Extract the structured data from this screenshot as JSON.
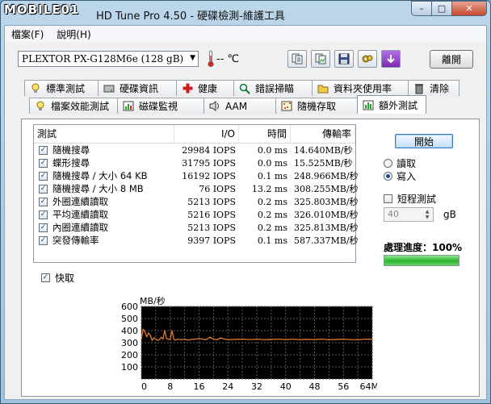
{
  "window": {
    "logo": "MOBILE01",
    "title": "HD Tune Pro 4.50 - 硬碟檢測-維護工具",
    "minimize_icon": "–",
    "maximize_icon": "□",
    "close_icon": "✕"
  },
  "menu": {
    "file": "檔案(F)",
    "help": "說明(H)"
  },
  "toolbar": {
    "drive": "PLEXTOR PX-G128M6e (128 gB)",
    "temperature": "-- ℃",
    "exit_label": "離開",
    "icons": [
      "copy-text-icon",
      "copy-screenshot-icon",
      "save-icon",
      "options-icon",
      "download-icon"
    ]
  },
  "tabs_row1": [
    {
      "label": "標準測試",
      "icon": "bulb-icon"
    },
    {
      "label": "硬碟資訊",
      "icon": "drive-info-icon"
    },
    {
      "label": "健康",
      "icon": "health-cross-icon"
    },
    {
      "label": "錯誤掃瞄",
      "icon": "magnifier-icon"
    },
    {
      "label": "資料夾使用率",
      "icon": "folder-icon"
    },
    {
      "label": "清除",
      "icon": "trash-icon"
    }
  ],
  "tabs_row2": [
    {
      "label": "檔案效能測試",
      "icon": "bulb-icon"
    },
    {
      "label": "磁碟監視",
      "icon": "monitor-chart-icon"
    },
    {
      "label": "AAM",
      "icon": "speaker-icon"
    },
    {
      "label": "隨機存取",
      "icon": "random-access-icon"
    },
    {
      "label": "額外測試",
      "icon": "extra-test-icon",
      "active": true
    }
  ],
  "results": {
    "headers": {
      "test": "測試",
      "io": "I/O",
      "time": "時間",
      "rate": "傳輸率"
    },
    "rows": [
      {
        "name": "隨機搜尋",
        "io": "29984 IOPS",
        "time": "0.0 ms",
        "rate": "14.640MB/秒"
      },
      {
        "name": "蝶形搜尋",
        "io": "31795 IOPS",
        "time": "0.0 ms",
        "rate": "15.525MB/秒"
      },
      {
        "name": "隨機搜尋 / 大小 64 KB",
        "io": "16192 IOPS",
        "time": "0.1 ms",
        "rate": "248.966MB/秒"
      },
      {
        "name": "隨機搜尋 / 大小 8 MB",
        "io": "76 IOPS",
        "time": "13.2 ms",
        "rate": "308.255MB/秒"
      },
      {
        "name": "外圈連續讀取",
        "io": "5213 IOPS",
        "time": "0.2 ms",
        "rate": "325.803MB/秒"
      },
      {
        "name": "平均連續讀取",
        "io": "5216 IOPS",
        "time": "0.2 ms",
        "rate": "326.010MB/秒"
      },
      {
        "name": "內圈連續讀取",
        "io": "5213 IOPS",
        "time": "0.2 ms",
        "rate": "325.813MB/秒"
      },
      {
        "name": "突發傳輸率",
        "io": "9397 IOPS",
        "time": "0.1 ms",
        "rate": "587.337MB/秒"
      }
    ]
  },
  "controls": {
    "start_label": "開始",
    "read_label": "讀取",
    "write_label": "寫入",
    "mode": "write",
    "short_test_label": "短程測試",
    "short_value": "40",
    "short_unit": "gB",
    "progress_label": "處理進度：100%",
    "progress_fraction": 1.0,
    "quick_label": "快取"
  },
  "chart_data": {
    "type": "line",
    "ylabel": "MB/秒",
    "xlabel": "MB",
    "ylim": [
      0,
      600
    ],
    "xlim": [
      0,
      64
    ],
    "y_ticks": [
      600,
      500,
      400,
      300,
      200,
      100
    ],
    "x_ticks": [
      "0",
      "8",
      "16",
      "24",
      "32",
      "40",
      "48",
      "56",
      "64MB"
    ],
    "grid": true,
    "series": [
      {
        "color": "#e07b2c",
        "x": [
          0,
          0.5,
          1,
          1.5,
          2,
          2.5,
          3,
          3.5,
          4,
          4.5,
          5,
          5.5,
          6,
          6.5,
          7,
          7.5,
          8,
          8.5,
          9,
          9.5,
          10,
          11,
          12,
          13,
          14,
          15,
          16,
          17,
          18,
          19,
          20,
          21,
          22,
          23,
          24,
          26,
          28,
          30,
          32,
          34,
          36,
          38,
          40,
          42,
          44,
          46,
          48,
          50,
          52,
          54,
          56,
          58,
          60,
          62,
          64
        ],
        "values": [
          330,
          410,
          390,
          350,
          380,
          360,
          320,
          340,
          330,
          320,
          325,
          345,
          330,
          400,
          335,
          330,
          325,
          400,
          330,
          320,
          330,
          325,
          330,
          322,
          328,
          330,
          335,
          330,
          325,
          345,
          330,
          325,
          340,
          330,
          325,
          328,
          330,
          326,
          330,
          325,
          327,
          330,
          326,
          330,
          325,
          328,
          326,
          330,
          325,
          327,
          330,
          326,
          325,
          330,
          328
        ]
      }
    ]
  }
}
